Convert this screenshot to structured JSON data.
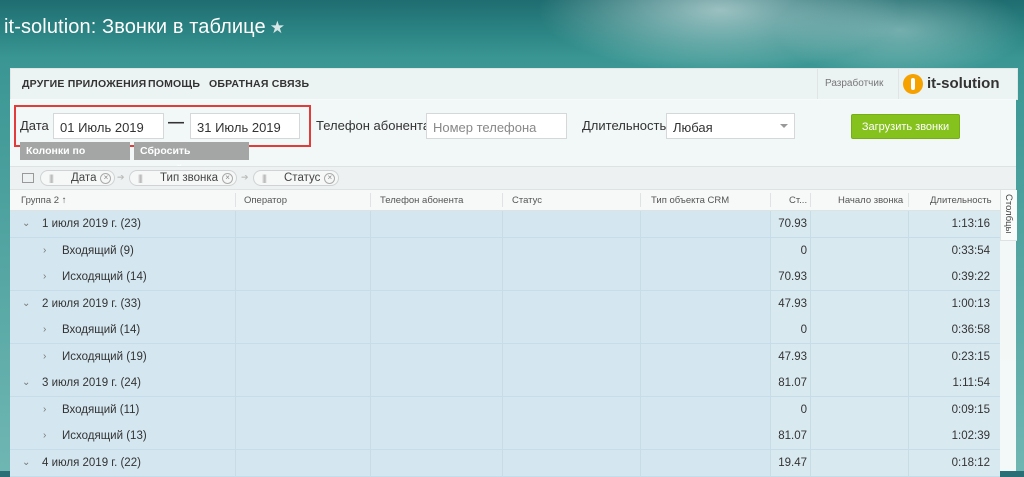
{
  "page": {
    "title": "it-solution: Звонки в таблице",
    "star": "★"
  },
  "menu": {
    "items": [
      "ДРУГИЕ ПРИЛОЖЕНИЯ",
      "ПОМОЩЬ",
      "ОБРАТНАЯ СВЯЗЬ"
    ],
    "developer_label": "Разработчик",
    "logo_text": "it-solution"
  },
  "filters": {
    "date_label": "Дата",
    "date_from": "01 Июль 2019",
    "date_to": "31 Июль 2019",
    "phone_label": "Телефон абонента",
    "phone_placeholder": "Номер телефона",
    "duration_label": "Длительность",
    "duration_value": "Любая",
    "load_button": "Загрузить звонки",
    "fit_columns_button": "Колонки по ширине",
    "reset_button": "Сбросить настройки"
  },
  "grouping": {
    "chips": [
      "Дата",
      "Тип звонка",
      "Статус"
    ]
  },
  "table": {
    "headers": {
      "group": "Группа 2",
      "operator": "Оператор",
      "phone": "Телефон абонента",
      "status": "Статус",
      "crm_type": "Тип объекта CRM",
      "cost": "Ст...",
      "start": "Начало звонка",
      "duration": "Длительность"
    },
    "side_tab": "Столбцы",
    "rows": [
      {
        "level": 0,
        "label": "1 июля 2019 г. (23)",
        "cost": "70.93",
        "duration": "1:13:16",
        "expanded": true
      },
      {
        "level": 1,
        "label": "Входящий (9)",
        "cost": "0",
        "duration": "0:33:54",
        "expanded": false
      },
      {
        "level": 1,
        "label": "Исходящий (14)",
        "cost": "70.93",
        "duration": "0:39:22",
        "expanded": false
      },
      {
        "level": 0,
        "label": "2 июля 2019 г. (33)",
        "cost": "47.93",
        "duration": "1:00:13",
        "expanded": true
      },
      {
        "level": 1,
        "label": "Входящий (14)",
        "cost": "0",
        "duration": "0:36:58",
        "expanded": false
      },
      {
        "level": 1,
        "label": "Исходящий (19)",
        "cost": "47.93",
        "duration": "0:23:15",
        "expanded": false
      },
      {
        "level": 0,
        "label": "3 июля 2019 г. (24)",
        "cost": "81.07",
        "duration": "1:11:54",
        "expanded": true
      },
      {
        "level": 1,
        "label": "Входящий (11)",
        "cost": "0",
        "duration": "0:09:15",
        "expanded": false
      },
      {
        "level": 1,
        "label": "Исходящий (13)",
        "cost": "81.07",
        "duration": "1:02:39",
        "expanded": false
      },
      {
        "level": 0,
        "label": "4 июля 2019 г. (22)",
        "cost": "19.47",
        "duration": "0:18:12",
        "expanded": true
      }
    ]
  },
  "colors": {
    "accent_green": "#86c21d",
    "highlight_red": "#e33a3a",
    "row_blue": "#d4e6ef",
    "logo_orange": "#f5a100"
  }
}
